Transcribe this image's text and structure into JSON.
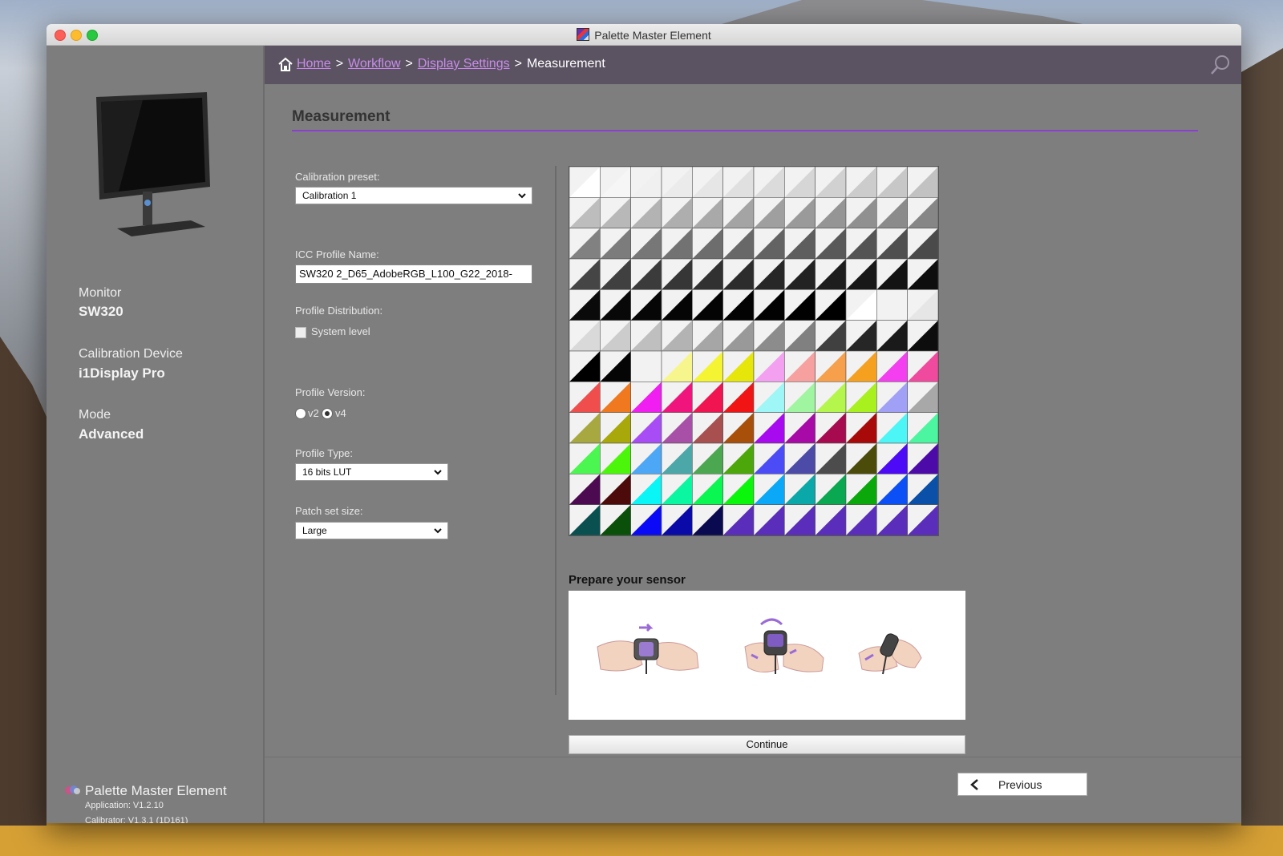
{
  "window": {
    "title": "Palette Master Element"
  },
  "sidebar": {
    "monitor_label": "Monitor",
    "monitor_value": "SW320",
    "device_label": "Calibration Device",
    "device_value": "i1Display Pro",
    "mode_label": "Mode",
    "mode_value": "Advanced",
    "app_name": "Palette Master Element",
    "app_version": "Application: V1.2.10",
    "calibrator_version": "Calibrator: V1.3.1 (1D161)"
  },
  "breadcrumb": {
    "home": "Home",
    "workflow": "Workflow",
    "display_settings": "Display Settings",
    "current": "Measurement",
    "separator": ">"
  },
  "page": {
    "title": "Measurement"
  },
  "form": {
    "calibration_preset_label": "Calibration preset:",
    "calibration_preset_value": "Calibration 1",
    "icc_profile_label": "ICC Profile Name:",
    "icc_profile_value": "SW320 2_D65_AdobeRGB_L100_G22_2018-",
    "profile_distribution_label": "Profile Distribution:",
    "system_level_label": "System level",
    "system_level_checked": false,
    "profile_version_label": "Profile Version:",
    "v2_label": "v2",
    "v4_label": "v4",
    "profile_version_selected": "v4",
    "profile_type_label": "Profile Type:",
    "profile_type_value": "16 bits LUT",
    "patch_set_label": "Patch set size:",
    "patch_set_value": "Large"
  },
  "sensor": {
    "title": "Prepare your sensor"
  },
  "buttons": {
    "continue": "Continue",
    "previous": "Previous"
  },
  "icons": [
    "home-icon",
    "search-icon",
    "chevron-down-icon",
    "arrow-left-icon",
    "monitor-icon"
  ],
  "patches": [
    [
      "#ffffff",
      "#f6f6f6",
      "#f0f0f0",
      "#ebebeb",
      "#e6e6e6",
      "#e0e0e0",
      "#dbdbdb",
      "#d6d6d6",
      "#d1d1d1",
      "#cccccc",
      "#c7c7c7",
      "#c2c2c2"
    ],
    [
      "#bdbdbd",
      "#b8b8b8",
      "#b3b3b3",
      "#aeaeae",
      "#a9a9a9",
      "#a4a4a4",
      "#9f9f9f",
      "#9a9a9a",
      "#959595",
      "#909090",
      "#8b8b8b",
      "#868686"
    ],
    [
      "#818181",
      "#7c7c7c",
      "#777777",
      "#727272",
      "#6d6d6d",
      "#686868",
      "#636363",
      "#5e5e5e",
      "#595959",
      "#545454",
      "#4f4f4f",
      "#4a4a4a"
    ],
    [
      "#454545",
      "#404040",
      "#3b3b3b",
      "#363636",
      "#313131",
      "#2c2c2c",
      "#272727",
      "#222222",
      "#1d1d1d",
      "#181818",
      "#131313",
      "#0e0e0e"
    ],
    [
      "#0a0a0a",
      "#080808",
      "#060606",
      "#050505",
      "#040404",
      "#030303",
      "#020202",
      "#010101",
      "#000000",
      "#ffffff",
      "#f2f2f2",
      "#e6e6e6"
    ],
    [
      "#d9d9d9",
      "#cccccc",
      "#bfbfbf",
      "#b3b3b3",
      "#a6a6a6",
      "#999999",
      "#8c8c8c",
      "#808080",
      "#404040",
      "#262626",
      "#1a1a1a",
      "#0d0d0d"
    ],
    [
      "#000000",
      "#050505",
      "#f2f2f2",
      "#f6f68c",
      "#f4f433",
      "#e6e60a",
      "#f3a0f0",
      "#f6a0a0",
      "#f6a04c",
      "#f5a01e",
      "#f33ff0",
      "#f04a9e"
    ],
    [
      "#f04d4d",
      "#f0781e",
      "#f01ef0",
      "#f0147d",
      "#f01450",
      "#f01414",
      "#9ef6f6",
      "#a0f6a0",
      "#b4f64c",
      "#a8f01e",
      "#a0a0f6",
      "#a8a8a8"
    ],
    [
      "#a8a840",
      "#a8a80a",
      "#a84cf6",
      "#a850a8",
      "#a85050",
      "#a8500a",
      "#a80af0",
      "#a80aa8",
      "#a80a50",
      "#a80a0a",
      "#4cf6f6",
      "#4cf6a0"
    ],
    [
      "#4cf650",
      "#4cf60a",
      "#4ca8f6",
      "#4ca8a8",
      "#4ca850",
      "#4ca80a",
      "#4c4cf6",
      "#4c4ca8",
      "#4c4c4c",
      "#4c4c0a",
      "#4c0af6",
      "#4c0aa8"
    ],
    [
      "#4c0a50",
      "#4c0a0a",
      "#0af6f6",
      "#0af6a0",
      "#0af650",
      "#0af60a",
      "#0aa8f6",
      "#0aa8a8",
      "#0aa850",
      "#0aa80a",
      "#0a50f6",
      "#0a50a8"
    ],
    [
      "#0a5050",
      "#0a500a",
      "#0a0af6",
      "#0a0aa8",
      "#0a0a50",
      "#5a2dbb",
      "#5a2dbb",
      "#5a2dbb",
      "#5a2dbb",
      "#5a2dbb",
      "#5a2dbb",
      "#5a2dbb"
    ]
  ]
}
